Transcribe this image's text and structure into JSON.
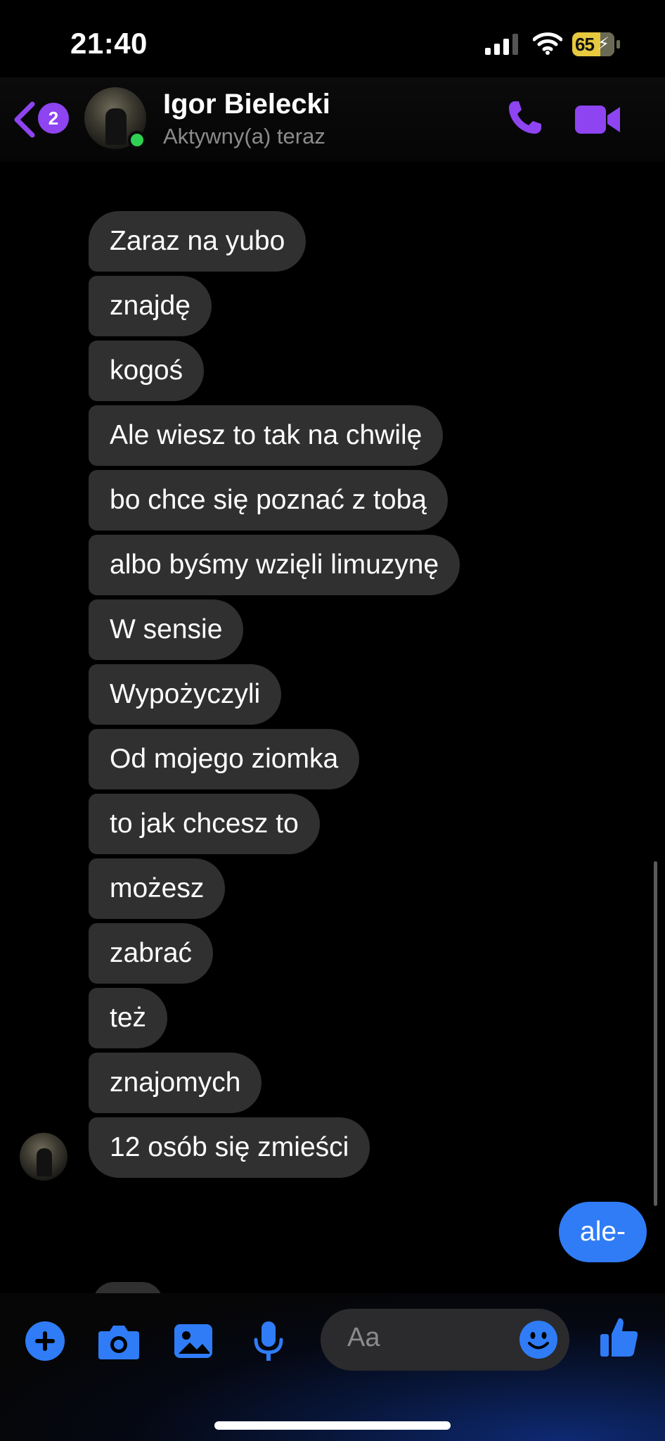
{
  "status": {
    "time": "21:40",
    "battery": "65"
  },
  "header": {
    "back_badge": "2",
    "contact_name": "Igor Bielecki",
    "presence": "Aktywny(a) teraz"
  },
  "messages": {
    "incoming": [
      "Zaraz na yubo",
      "znajdę",
      "kogoś",
      "Ale wiesz to tak na chwilę",
      "bo chce się poznać z tobą",
      "albo byśmy wzięli limuzynę",
      "W sensie",
      "Wypożyczyli",
      "Od mojego ziomka",
      "to jak chcesz to",
      "możesz",
      "zabrać",
      "też",
      "znajomych",
      "12 osób się zmieści"
    ],
    "outgoing": [
      "ale-"
    ]
  },
  "composer": {
    "placeholder": "Aa"
  },
  "colors": {
    "accent_purple": "#8e44f0",
    "accent_blue": "#2f7cf6",
    "bubble_gray": "#303030",
    "online_green": "#2fd052"
  },
  "icons": [
    "back-chevron-icon",
    "phone-icon",
    "video-camera-icon",
    "plus-icon",
    "camera-icon",
    "image-icon",
    "microphone-icon",
    "emoji-icon",
    "thumbs-up-icon",
    "signal-icon",
    "wifi-icon",
    "battery-icon"
  ]
}
